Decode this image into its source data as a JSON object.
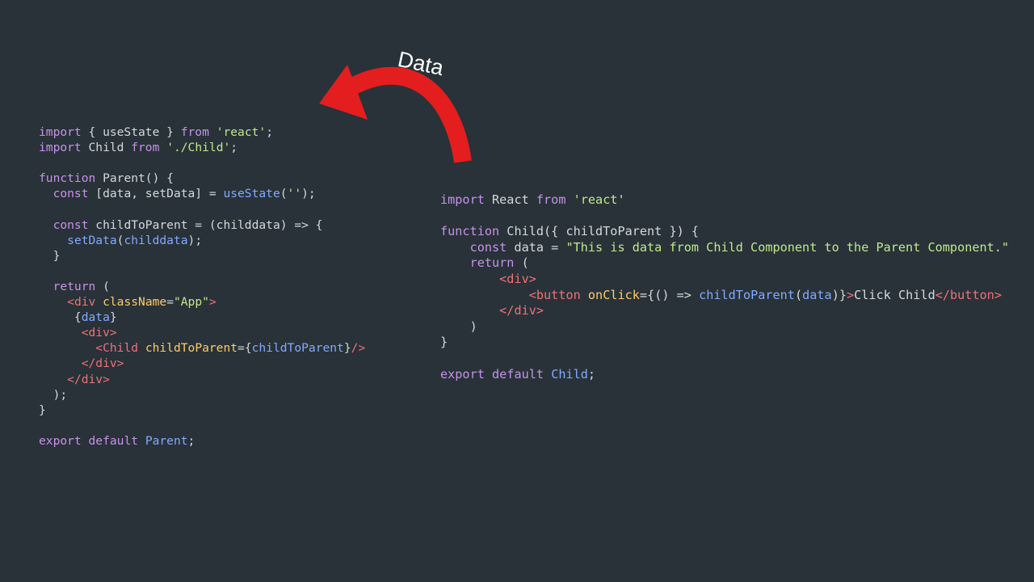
{
  "arrow": {
    "label": "Data",
    "color": "#e41e1e"
  },
  "colors": {
    "background": "#283238",
    "keyword": "#c792ea",
    "string": "#c3e88d",
    "function": "#82aaff",
    "tag": "#f07178",
    "attribute": "#ffcb6b",
    "plain": "#d4d9de"
  },
  "parent_code": [
    [
      [
        "kw",
        "import"
      ],
      [
        "plain",
        " { useState } "
      ],
      [
        "kw",
        "from"
      ],
      [
        "plain",
        " "
      ],
      [
        "str",
        "'react'"
      ],
      [
        "plain",
        ";"
      ]
    ],
    [
      [
        "kw",
        "import"
      ],
      [
        "plain",
        " Child "
      ],
      [
        "kw",
        "from"
      ],
      [
        "plain",
        " "
      ],
      [
        "str",
        "'./Child'"
      ],
      [
        "plain",
        ";"
      ]
    ],
    [],
    [
      [
        "kw",
        "function"
      ],
      [
        "plain",
        " Parent() {"
      ]
    ],
    [
      [
        "plain",
        "  "
      ],
      [
        "kw",
        "const"
      ],
      [
        "plain",
        " [data, setData] = "
      ],
      [
        "fn",
        "useState"
      ],
      [
        "plain",
        "("
      ],
      [
        "str",
        "''"
      ],
      [
        "plain",
        ");"
      ]
    ],
    [],
    [
      [
        "plain",
        "  "
      ],
      [
        "kw",
        "const"
      ],
      [
        "plain",
        " childToParent = (childdata) => {"
      ]
    ],
    [
      [
        "plain",
        "    "
      ],
      [
        "fn",
        "setData"
      ],
      [
        "plain",
        "("
      ],
      [
        "var",
        "childdata"
      ],
      [
        "plain",
        ");"
      ]
    ],
    [
      [
        "plain",
        "  }"
      ]
    ],
    [],
    [
      [
        "plain",
        "  "
      ],
      [
        "kw",
        "return"
      ],
      [
        "plain",
        " ("
      ]
    ],
    [
      [
        "plain",
        "    "
      ],
      [
        "tag",
        "<div"
      ],
      [
        "plain",
        " "
      ],
      [
        "attr",
        "className"
      ],
      [
        "plain",
        "="
      ],
      [
        "str",
        "\"App\""
      ],
      [
        "tag",
        ">"
      ]
    ],
    [
      [
        "plain",
        "     {"
      ],
      [
        "var",
        "data"
      ],
      [
        "plain",
        "}"
      ]
    ],
    [
      [
        "plain",
        "      "
      ],
      [
        "tag",
        "<div>"
      ]
    ],
    [
      [
        "plain",
        "        "
      ],
      [
        "tag",
        "<Child"
      ],
      [
        "plain",
        " "
      ],
      [
        "attr",
        "childToParent"
      ],
      [
        "plain",
        "={"
      ],
      [
        "var",
        "childToParent"
      ],
      [
        "plain",
        "}"
      ],
      [
        "tag",
        "/>"
      ]
    ],
    [
      [
        "plain",
        "      "
      ],
      [
        "tag",
        "</div>"
      ]
    ],
    [
      [
        "plain",
        "    "
      ],
      [
        "tag",
        "</div>"
      ]
    ],
    [
      [
        "plain",
        "  );"
      ]
    ],
    [
      [
        "plain",
        "}"
      ]
    ],
    [],
    [
      [
        "kw",
        "export"
      ],
      [
        "plain",
        " "
      ],
      [
        "kw",
        "default"
      ],
      [
        "plain",
        " "
      ],
      [
        "fn",
        "Parent"
      ],
      [
        "plain",
        ";"
      ]
    ]
  ],
  "child_code": [
    [
      [
        "kw",
        "import"
      ],
      [
        "plain",
        " React "
      ],
      [
        "kw",
        "from"
      ],
      [
        "plain",
        " "
      ],
      [
        "str",
        "'react'"
      ]
    ],
    [],
    [
      [
        "kw",
        "function"
      ],
      [
        "plain",
        " Child({ childToParent }) {"
      ]
    ],
    [
      [
        "plain",
        "    "
      ],
      [
        "kw",
        "const"
      ],
      [
        "plain",
        " data = "
      ],
      [
        "str",
        "\"This is data from Child Component to the Parent Component.\""
      ]
    ],
    [
      [
        "plain",
        "    "
      ],
      [
        "kw",
        "return"
      ],
      [
        "plain",
        " ("
      ]
    ],
    [
      [
        "plain",
        "        "
      ],
      [
        "tag",
        "<div>"
      ]
    ],
    [
      [
        "plain",
        "            "
      ],
      [
        "tag",
        "<button"
      ],
      [
        "plain",
        " "
      ],
      [
        "attr",
        "onClick"
      ],
      [
        "plain",
        "={() => "
      ],
      [
        "fn",
        "childToParent"
      ],
      [
        "plain",
        "("
      ],
      [
        "var",
        "data"
      ],
      [
        "plain",
        ")}"
      ],
      [
        "tag",
        ">"
      ],
      [
        "plain",
        "Click Child"
      ],
      [
        "tag",
        "</button>"
      ]
    ],
    [
      [
        "plain",
        "        "
      ],
      [
        "tag",
        "</div>"
      ]
    ],
    [
      [
        "plain",
        "    )"
      ]
    ],
    [
      [
        "plain",
        "}"
      ]
    ],
    [],
    [
      [
        "kw",
        "export"
      ],
      [
        "plain",
        " "
      ],
      [
        "kw",
        "default"
      ],
      [
        "plain",
        " "
      ],
      [
        "fn",
        "Child"
      ],
      [
        "plain",
        ";"
      ]
    ]
  ]
}
